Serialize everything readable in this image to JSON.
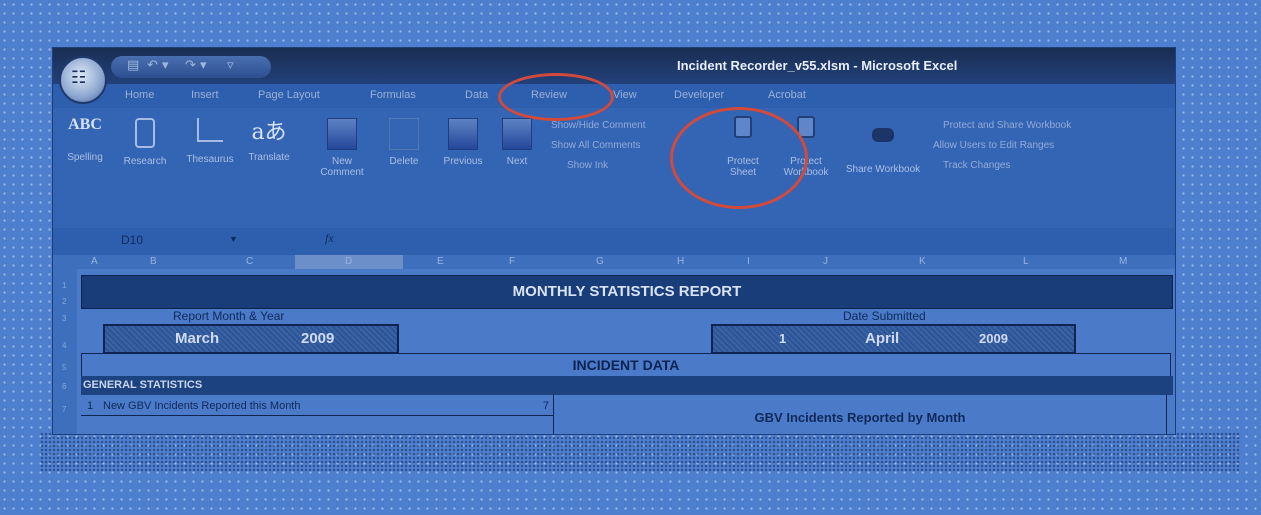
{
  "window": {
    "title": "Incident Recorder_v55.xlsm - Microsoft Excel",
    "office_button": "Office"
  },
  "qat": {
    "save": "save-icon",
    "undo": "↶ ▾",
    "redo": "↷ ▾",
    "customize": "▿"
  },
  "tabs": [
    "Home",
    "Insert",
    "Page Layout",
    "Formulas",
    "Data",
    "Review",
    "View",
    "Developer",
    "Acrobat"
  ],
  "active_tab": "Review",
  "ribbon": {
    "spelling": {
      "icon_text": "ABC",
      "label": "Spelling"
    },
    "research": {
      "label": "Research"
    },
    "thesaurus": {
      "label": "Thesaurus"
    },
    "translate": {
      "icon_text": "aあ",
      "label": "Translate"
    },
    "new_comment": {
      "label": "New Comment"
    },
    "delete": {
      "label": "Delete"
    },
    "previous": {
      "label": "Previous"
    },
    "next": {
      "label": "Next"
    },
    "show_hide_comment": "Show/Hide Comment",
    "show_all_comments": "Show All Comments",
    "show_ink": "Show Ink",
    "protect_sheet": {
      "label": "Protect Sheet"
    },
    "protect_workbook": {
      "label": "Protect Workbook"
    },
    "share_workbook": {
      "label": "Share Workbook"
    },
    "protect_and_share": "Protect and Share Workbook",
    "allow_users": "Allow Users to Edit Ranges",
    "track_changes": "Track Changes"
  },
  "formula_bar": {
    "cell": "D10",
    "fx": "fx",
    "value": ""
  },
  "columns": [
    "A",
    "B",
    "C",
    "D",
    "E",
    "F",
    "G",
    "H",
    "I",
    "J",
    "K",
    "L",
    "M"
  ],
  "rows": [
    "1",
    "2",
    "3",
    "4",
    "5",
    "6",
    "7"
  ],
  "sheet": {
    "title": "MONTHLY STATISTICS REPORT",
    "report_month_label": "Report Month & Year",
    "report_month": "March",
    "report_year": "2009",
    "date_submitted_label": "Date Submitted",
    "sub_day": "1",
    "sub_month": "April",
    "sub_year": "2009",
    "incident_data": "INCIDENT DATA",
    "general_statistics": "GENERAL STATISTICS",
    "row7_num": "1",
    "row7_label": "New GBV Incidents Reported this Month",
    "row7_value": "7",
    "chart_title": "GBV Incidents Reported by Month"
  },
  "colors": {
    "page_bg": "#4d7fce",
    "title_bar": "#1a2e52",
    "header_band": "#183d78",
    "highlight_circle": "#d24a3c"
  }
}
